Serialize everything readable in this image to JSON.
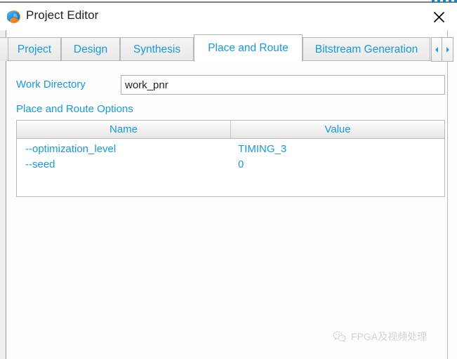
{
  "window": {
    "title": "Project Editor",
    "app_icon": "gowin-swirl-icon",
    "close_icon": "close-icon"
  },
  "tabs": {
    "items": [
      {
        "label": "Project",
        "active": false
      },
      {
        "label": "Design",
        "active": false
      },
      {
        "label": "Synthesis",
        "active": false
      },
      {
        "label": "Place and Route",
        "active": true
      },
      {
        "label": "Bitstream Generation",
        "active": false
      }
    ],
    "scroll_left_icon": "chevron-left-icon",
    "scroll_right_icon": "chevron-right-icon"
  },
  "form": {
    "work_directory_label": "Work Directory",
    "work_directory_value": "work_pnr",
    "work_directory_placeholder": ""
  },
  "options": {
    "section_title": "Place and Route Options",
    "columns": [
      "Name",
      "Value"
    ],
    "rows": [
      {
        "name": "--optimization_level",
        "value": "TIMING_3"
      },
      {
        "name": "--seed",
        "value": "0"
      }
    ]
  },
  "watermark": {
    "icon": "wechat-icon",
    "text": "FPGA及视频处理"
  },
  "colors": {
    "accent_text": "#169ad6",
    "title_text": "#1f1f1f",
    "tab_border": "#b7b7b7",
    "page_background": "#fdfdfd"
  }
}
